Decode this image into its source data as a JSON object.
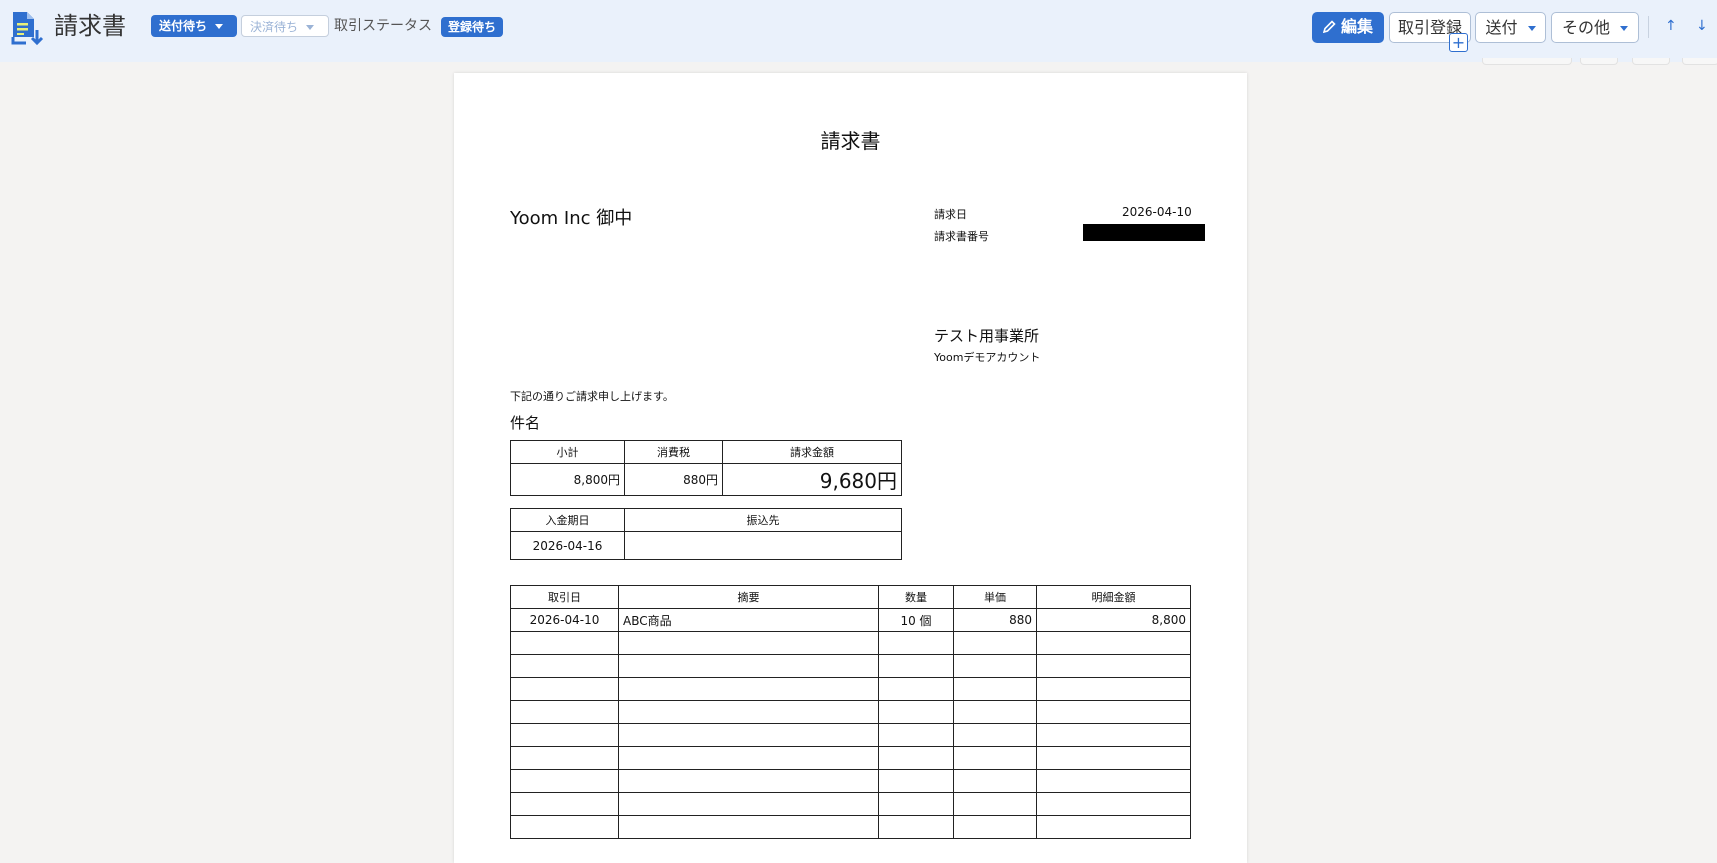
{
  "header": {
    "title": "請求書",
    "send_status": "送付待ち",
    "settle_status": "決済待ち",
    "trade_status_label": "取引ステータス",
    "registration_badge": "登録待ち",
    "edit_label": "編集",
    "trade_register_label": "取引登録",
    "send_label": "送付",
    "other_label": "その他",
    "plus_label": "+",
    "up_arrow": "↑",
    "down_arrow": "↓"
  },
  "colors": {
    "accent": "#2f6fcf",
    "topbar": "#eaf1fb",
    "background": "#f4f3f2"
  },
  "invoice": {
    "title": "請求書",
    "client": "Yoom Inc 御中",
    "date_label": "請求日",
    "date_value": "2026-04-10",
    "number_label": "請求書番号",
    "office": "テスト用事業所",
    "account": "Yoomデモアカウント",
    "intro": "下記の通りご請求申し上げます。",
    "subject_label": "件名",
    "summary": {
      "headers": [
        "小計",
        "消費税",
        "請求金額"
      ],
      "subtotal": "8,800円",
      "tax": "880円",
      "total": "9,680円"
    },
    "payment": {
      "headers": [
        "入金期日",
        "振込先"
      ],
      "due_date": "2026-04-16",
      "bank": ""
    },
    "items": {
      "headers": [
        "取引日",
        "摘要",
        "数量",
        "単価",
        "明細金額"
      ],
      "rows": [
        [
          "2026-04-10",
          "ABC商品",
          "10 個",
          "880",
          "8,800"
        ],
        [
          "",
          "",
          "",
          "",
          ""
        ],
        [
          "",
          "",
          "",
          "",
          ""
        ],
        [
          "",
          "",
          "",
          "",
          ""
        ],
        [
          "",
          "",
          "",
          "",
          ""
        ],
        [
          "",
          "",
          "",
          "",
          ""
        ],
        [
          "",
          "",
          "",
          "",
          ""
        ],
        [
          "",
          "",
          "",
          "",
          ""
        ],
        [
          "",
          "",
          "",
          "",
          ""
        ],
        [
          "",
          "",
          "",
          "",
          ""
        ]
      ]
    }
  }
}
